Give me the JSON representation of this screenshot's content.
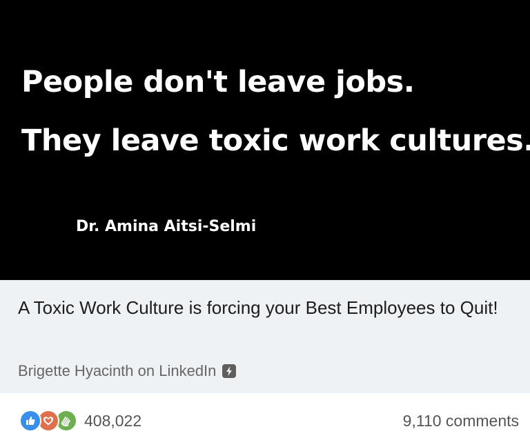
{
  "quote": {
    "line1": "People don't leave jobs.",
    "line2": "They leave toxic work cultures.",
    "author": "Dr. Amina Aitsi-Selmi"
  },
  "link_preview": {
    "title": "A Toxic Work Culture is forcing your Best Employees to Quit!",
    "source": "Brigette Hyacinth on LinkedIn",
    "source_icon": "amp-lightning-icon"
  },
  "social": {
    "reactions": [
      {
        "name": "like",
        "icon": "thumbs-up-icon",
        "color": "#378fe9"
      },
      {
        "name": "love",
        "icon": "heart-icon",
        "color": "#df704d"
      },
      {
        "name": "support",
        "icon": "clapping-hands-icon",
        "color": "#6dae4f"
      }
    ],
    "reaction_count": "408,022",
    "comments": "9,110 comments"
  },
  "colors": {
    "image_background": "#000000",
    "preview_background": "#eef2f5",
    "secondary_text": "#666666"
  }
}
